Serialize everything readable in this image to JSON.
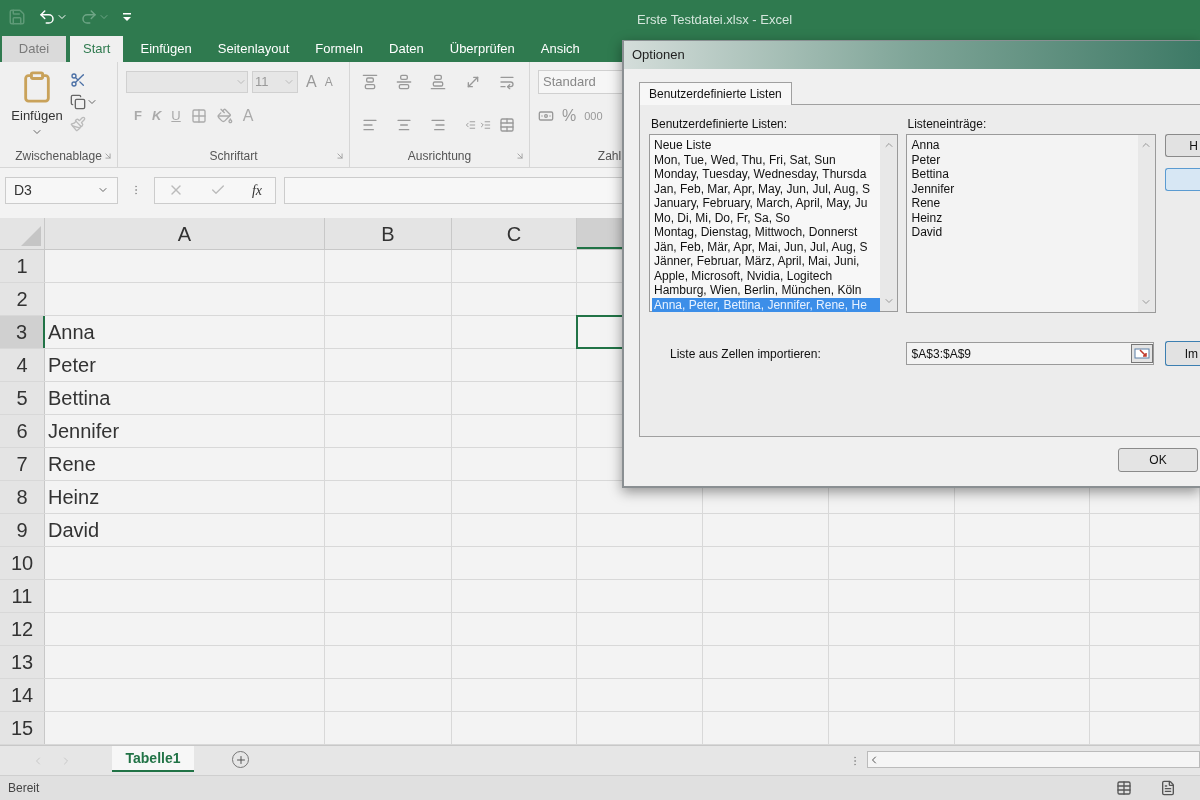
{
  "title_bar": {
    "title": "Erste Testdatei.xlsx - Excel"
  },
  "ribbon_tabs": [
    {
      "label": "Datei",
      "selected": false,
      "disabled": true
    },
    {
      "label": "Start",
      "selected": true,
      "disabled": false
    },
    {
      "label": "Einfügen",
      "selected": false,
      "disabled": false
    },
    {
      "label": "Seitenlayout",
      "selected": false,
      "disabled": false
    },
    {
      "label": "Formeln",
      "selected": false,
      "disabled": false
    },
    {
      "label": "Daten",
      "selected": false,
      "disabled": false
    },
    {
      "label": "Überprüfen",
      "selected": false,
      "disabled": false
    },
    {
      "label": "Ansich",
      "selected": false,
      "disabled": false
    }
  ],
  "ribbon": {
    "clipboard": {
      "paste": "Einfügen",
      "label": "Zwischenablage"
    },
    "font": {
      "size": "11",
      "grow": "A",
      "shrink": "A",
      "bold": "F",
      "italic": "K",
      "underline": "U",
      "font_color": "A",
      "label": "Schriftart"
    },
    "alignment": {
      "label": "Ausrichtung"
    },
    "number": {
      "format": "Standard",
      "percent": "%",
      "thousands": "000",
      "label": "Zahl"
    }
  },
  "formula_bar": {
    "name_box": "D3",
    "function_label": "fx"
  },
  "sheet": {
    "columns": [
      {
        "label": "A",
        "selected": false
      },
      {
        "label": "B",
        "selected": false
      },
      {
        "label": "C",
        "selected": false
      },
      {
        "selected": true
      }
    ],
    "rows": [
      {
        "number": "1",
        "selected": false
      },
      {
        "number": "2",
        "selected": false
      },
      {
        "number": "3",
        "selected": true,
        "value": "Anna"
      },
      {
        "number": "4",
        "selected": false,
        "value": "Peter"
      },
      {
        "number": "5",
        "selected": false,
        "value": "Bettina"
      },
      {
        "number": "6",
        "selected": false,
        "value": "Jennifer"
      },
      {
        "number": "7",
        "selected": false,
        "value": "Rene"
      },
      {
        "number": "8",
        "selected": false,
        "value": "Heinz"
      },
      {
        "number": "9",
        "selected": false,
        "value": "David"
      },
      {
        "number": "10",
        "selected": false
      },
      {
        "number": "11",
        "selected": false
      },
      {
        "number": "12",
        "selected": false
      },
      {
        "number": "13",
        "selected": false
      },
      {
        "number": "14",
        "selected": false
      },
      {
        "number": "15",
        "selected": false
      }
    ]
  },
  "sheet_tabs": [
    {
      "label": "Tabelle1",
      "selected": true
    }
  ],
  "status_bar": {
    "text": "Bereit"
  },
  "dialog": {
    "title": "Optionen",
    "tabs": [
      {
        "label": "Benutzerdefinierte Listen",
        "selected": true
      }
    ],
    "lists_label": "Benutzerdefinierte Listen:",
    "lists": [
      {
        "label": "Neue Liste",
        "selected": false
      },
      {
        "label": "Mon, Tue, Wed, Thu, Fri, Sat, Sun",
        "selected": false
      },
      {
        "label": "Monday, Tuesday, Wednesday, Thursda",
        "selected": false
      },
      {
        "label": "Jan, Feb, Mar, Apr, May, Jun, Jul, Aug, S",
        "selected": false
      },
      {
        "label": "January, February, March, April, May, Ju",
        "selected": false
      },
      {
        "label": "Mo, Di, Mi, Do, Fr, Sa, So",
        "selected": false
      },
      {
        "label": "Montag, Dienstag, Mittwoch, Donnerst",
        "selected": false
      },
      {
        "label": "Jän, Feb, Mär, Apr, Mai, Jun, Jul, Aug, S",
        "selected": false
      },
      {
        "label": "Jänner, Februar, März, April, Mai, Juni,",
        "selected": false
      },
      {
        "label": "Apple, Microsoft, Nvidia, Logitech",
        "selected": false
      },
      {
        "label": "Hamburg, Wien, Berlin, München, Köln",
        "selected": false
      },
      {
        "label": "Anna, Peter, Bettina, Jennifer, Rene, He",
        "selected": true
      }
    ],
    "entries_label": "Listeneinträge:",
    "entries": [
      "Anna",
      "Peter",
      "Bettina",
      "Jennifer",
      "Rene",
      "Heinz",
      "David"
    ],
    "side_buttons": [
      "H"
    ],
    "import_label": "Liste aus Zellen importieren:",
    "import_range": "$A$3:$A$9",
    "import_button": "Im",
    "ok_button": "OK"
  }
}
